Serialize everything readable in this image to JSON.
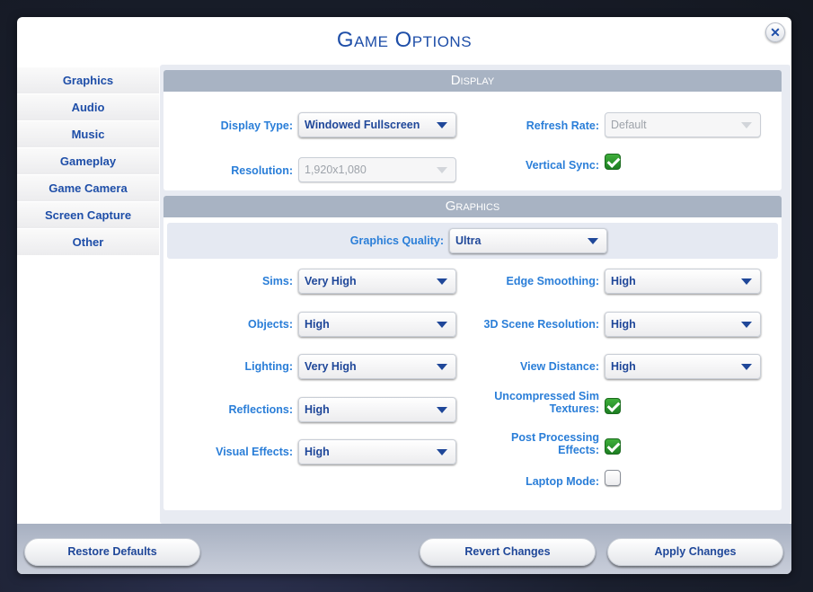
{
  "window": {
    "title": "Game Options",
    "close_label": "✕"
  },
  "sidebar": {
    "items": [
      {
        "label": "Graphics"
      },
      {
        "label": "Audio"
      },
      {
        "label": "Music"
      },
      {
        "label": "Gameplay"
      },
      {
        "label": "Game Camera"
      },
      {
        "label": "Screen Capture"
      },
      {
        "label": "Other"
      }
    ],
    "selected": "Graphics"
  },
  "display": {
    "header": "Display",
    "display_type": {
      "label": "Display Type:",
      "value": "Windowed Fullscreen",
      "enabled": true
    },
    "resolution": {
      "label": "Resolution:",
      "value": "1,920x1,080",
      "enabled": false
    },
    "refresh_rate": {
      "label": "Refresh Rate:",
      "value": "Default",
      "enabled": false
    },
    "vertical_sync": {
      "label": "Vertical Sync:",
      "checked": true
    }
  },
  "graphics": {
    "header": "Graphics",
    "quality": {
      "label": "Graphics Quality:",
      "value": "Ultra"
    },
    "sims": {
      "label": "Sims:",
      "value": "Very High"
    },
    "objects": {
      "label": "Objects:",
      "value": "High"
    },
    "lighting": {
      "label": "Lighting:",
      "value": "Very High"
    },
    "reflections": {
      "label": "Reflections:",
      "value": "High"
    },
    "visual_effects": {
      "label": "Visual Effects:",
      "value": "High"
    },
    "edge_smoothing": {
      "label": "Edge Smoothing:",
      "value": "High"
    },
    "scene_resolution": {
      "label": "3D Scene Resolution:",
      "value": "High"
    },
    "view_distance": {
      "label": "View Distance:",
      "value": "High"
    },
    "uncompressed_textures": {
      "label_line1": "Uncompressed Sim",
      "label_line2": "Textures:",
      "checked": true
    },
    "post_processing": {
      "label_line1": "Post Processing",
      "label_line2": "Effects:",
      "checked": true
    },
    "laptop_mode": {
      "label": "Laptop Mode:",
      "checked": false
    }
  },
  "footer": {
    "restore_defaults": "Restore Defaults",
    "revert_changes": "Revert Changes",
    "apply_changes": "Apply Changes"
  },
  "colors": {
    "accent_blue": "#1e4ea8",
    "label_blue": "#2a7ed8",
    "header_gray": "#a8b3c3",
    "check_green": "#2e9a2e"
  }
}
